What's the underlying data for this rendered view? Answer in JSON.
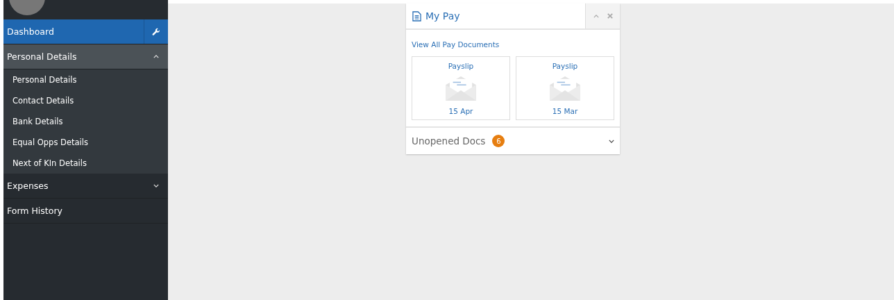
{
  "sidebar": {
    "items": [
      {
        "kind": "link",
        "label": "Dashboard",
        "selected": true
      },
      {
        "kind": "group",
        "label": "Personal Details",
        "selected": false,
        "expanded": true,
        "children": [
          {
            "label": "Personal Details"
          },
          {
            "label": "Contact Details"
          },
          {
            "label": "Bank Details"
          },
          {
            "label": "Equal Opps Details"
          },
          {
            "label": "Next of KIn Details"
          }
        ]
      },
      {
        "kind": "group",
        "label": "Expenses",
        "selected": false,
        "expanded": false
      },
      {
        "kind": "link",
        "label": "Form History",
        "selected": false
      }
    ]
  },
  "my_pay": {
    "title": "My Pay",
    "link": "View All Pay Documents",
    "expanded": true,
    "documents": [
      {
        "title": "Payslip",
        "date": "15 Apr"
      },
      {
        "title": "Payslip",
        "date": "15 Mar"
      }
    ],
    "unopened": {
      "label": "Unopened Docs",
      "count": "6",
      "expanded": false
    }
  }
}
